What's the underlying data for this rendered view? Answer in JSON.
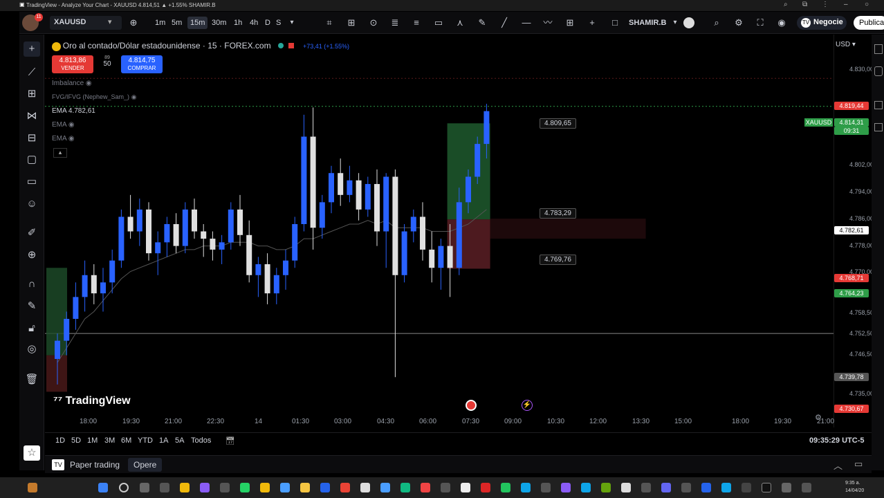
{
  "window": {
    "title": "TradingView - Analyze Your Chart - XAUUSD 4.814,51 ▲ +1.55% SHAMIR.B"
  },
  "toolbar": {
    "symbol": "XAUUSD",
    "timeframes": [
      "1m",
      "5m",
      "15m",
      "30m",
      "1h",
      "4h",
      "D",
      "S"
    ],
    "active_timeframe": "15m",
    "account": "SHAMIR.B",
    "trade_label": "Negocie",
    "publish_label": "Publica"
  },
  "legend": {
    "instrument": "Oro al contado/Dólar estadounidense · 15 · FOREX.com",
    "change": "+73,41 (+1.55%)",
    "sell_price": "4.813,86",
    "sell_label": "VENDER",
    "spread": "50",
    "spread_top": "89",
    "buy_price": "4.814,75",
    "buy_label": "COMPRAR",
    "indicators": [
      {
        "name": "Imbalance",
        "value": ""
      },
      {
        "name": "FVG/IFVG (Nephew_Sam_)",
        "value": ""
      },
      {
        "name": "EMA",
        "value": "4.782,61"
      },
      {
        "name": "EMA",
        "value": ""
      },
      {
        "name": "EMA",
        "value": ""
      }
    ]
  },
  "currency": "USD",
  "price_axis": {
    "labels": [
      "4.830,00",
      "4.802,00",
      "4.794,00",
      "4.786,00",
      "4.778,00",
      "4.770,00",
      "4.758,50",
      "4.752,50",
      "4.746,50",
      "4.735,00"
    ],
    "badges": [
      {
        "text": "4.819,44",
        "color": "#e53935"
      },
      {
        "text": "4.814,31",
        "color": "#2e9d48"
      },
      {
        "text": "09:31",
        "color": "#2e9d48"
      },
      {
        "text": "4.782,61",
        "color": "#ffffff"
      },
      {
        "text": "4.768,71",
        "color": "#e53935"
      },
      {
        "text": "4.764,23",
        "color": "#2e9d48"
      },
      {
        "text": "4.739,78",
        "color": "#555555"
      },
      {
        "text": "4.730,67",
        "color": "#e53935"
      }
    ],
    "symbol_badge": "XAUUSD"
  },
  "callouts": [
    "4.809,65",
    "4.783,29",
    "4.769,76"
  ],
  "time_axis": [
    "18:00",
    "19:30",
    "21:00",
    "22:30",
    "14",
    "01:30",
    "03:00",
    "04:30",
    "06:00",
    "07:30",
    "09:00",
    "10:30",
    "12:00",
    "13:30",
    "15:00",
    "18:00",
    "19:30",
    "21:00"
  ],
  "range_buttons": [
    "1D",
    "5D",
    "1M",
    "3M",
    "6M",
    "YTD",
    "1A",
    "5A",
    "Todos"
  ],
  "clock": "09:35:29 UTC-5",
  "brand": "TradingView",
  "paper": {
    "label": "Paper trading",
    "button": "Opere"
  },
  "taskbar": {
    "time": "9:35 a.",
    "date": "14/04/20"
  },
  "chart_data": {
    "type": "candlestick",
    "up_color": "#2962ff",
    "down_color": "#e0e0e0",
    "candles": [
      [
        4745,
        4752,
        4738,
        4750
      ],
      [
        4750,
        4758,
        4746,
        4756
      ],
      [
        4756,
        4766,
        4753,
        4762
      ],
      [
        4762,
        4772,
        4758,
        4768
      ],
      [
        4768,
        4771,
        4760,
        4763
      ],
      [
        4763,
        4770,
        4758,
        4766
      ],
      [
        4766,
        4775,
        4763,
        4772
      ],
      [
        4772,
        4786,
        4770,
        4784
      ],
      [
        4784,
        4790,
        4778,
        4780
      ],
      [
        4780,
        4789,
        4776,
        4786
      ],
      [
        4786,
        4788,
        4772,
        4774
      ],
      [
        4774,
        4780,
        4768,
        4777
      ],
      [
        4777,
        4784,
        4773,
        4782
      ],
      [
        4782,
        4785,
        4774,
        4776
      ],
      [
        4776,
        4788,
        4774,
        4786
      ],
      [
        4786,
        4789,
        4778,
        4780
      ],
      [
        4780,
        4782,
        4773,
        4778
      ],
      [
        4778,
        4780,
        4772,
        4775
      ],
      [
        4775,
        4779,
        4771,
        4777
      ],
      [
        4777,
        4788,
        4775,
        4786
      ],
      [
        4786,
        4790,
        4776,
        4779
      ],
      [
        4779,
        4783,
        4766,
        4768
      ],
      [
        4768,
        4773,
        4762,
        4771
      ],
      [
        4771,
        4774,
        4760,
        4763
      ],
      [
        4763,
        4770,
        4760,
        4768
      ],
      [
        4768,
        4775,
        4764,
        4772
      ],
      [
        4772,
        4784,
        4770,
        4782
      ],
      [
        4782,
        4812,
        4780,
        4806
      ],
      [
        4806,
        4814,
        4775,
        4781
      ],
      [
        4781,
        4790,
        4778,
        4788
      ],
      [
        4788,
        4798,
        4785,
        4796
      ],
      [
        4796,
        4800,
        4787,
        4790
      ],
      [
        4790,
        4798,
        4788,
        4794
      ],
      [
        4794,
        4796,
        4783,
        4786
      ],
      [
        4786,
        4795,
        4784,
        4793
      ],
      [
        4793,
        4797,
        4776,
        4780
      ],
      [
        4780,
        4796,
        4770,
        4795
      ],
      [
        4795,
        4797,
        4740,
        4768
      ],
      [
        4768,
        4782,
        4766,
        4780
      ],
      [
        4780,
        4786,
        4777,
        4784
      ],
      [
        4784,
        4788,
        4772,
        4775
      ],
      [
        4775,
        4780,
        4766,
        4770
      ],
      [
        4770,
        4778,
        4764,
        4776
      ],
      [
        4776,
        4782,
        4762,
        4770
      ],
      [
        4770,
        4792,
        4768,
        4788
      ],
      [
        4788,
        4797,
        4785,
        4795
      ],
      [
        4795,
        4806,
        4793,
        4804
      ],
      [
        4804,
        4815,
        4800,
        4813
      ]
    ],
    "ema": [
      4744,
      4748,
      4752,
      4756,
      4758,
      4761,
      4764,
      4767,
      4769,
      4770,
      4771,
      4772,
      4773,
      4774,
      4775,
      4775,
      4776,
      4776,
      4776,
      4777,
      4777,
      4777,
      4776,
      4776,
      4775,
      4775,
      4776,
      4778,
      4778,
      4779,
      4780,
      4781,
      4782,
      4782,
      4783,
      4782,
      4783,
      4781,
      4781,
      4781,
      4781,
      4780,
      4780,
      4780,
      4781,
      4782,
      4784,
      4786
    ],
    "ymin": 4730,
    "ymax": 4834
  }
}
